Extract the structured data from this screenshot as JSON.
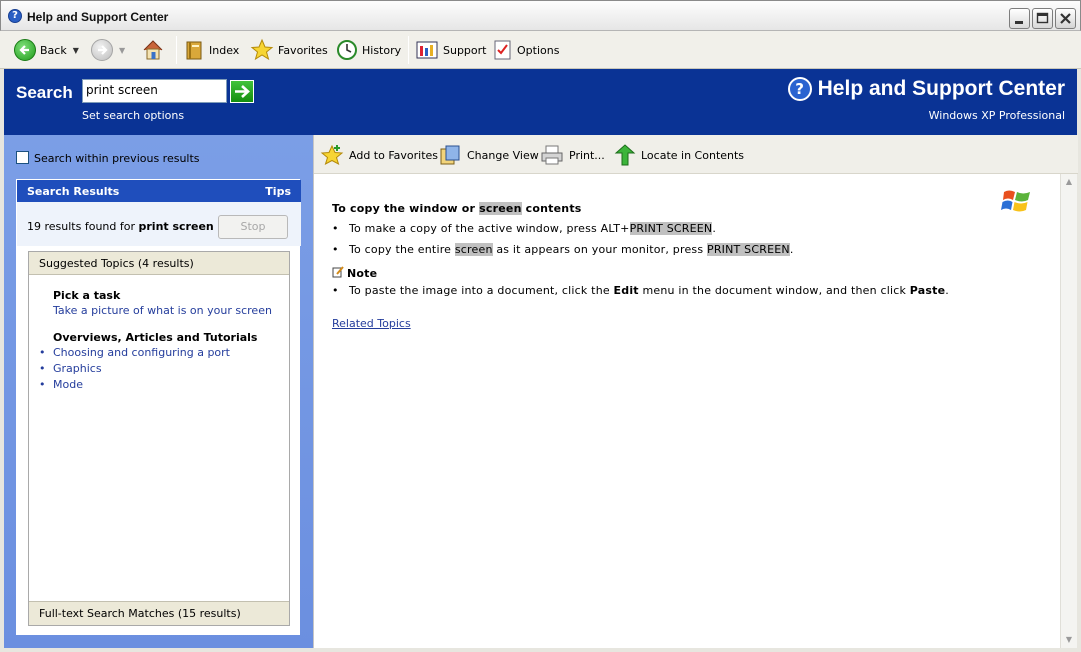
{
  "window": {
    "title": "Help and Support Center"
  },
  "toolbar": {
    "back": "Back",
    "index": "Index",
    "favorites": "Favorites",
    "history": "History",
    "support": "Support",
    "options": "Options"
  },
  "header": {
    "search_label": "Search",
    "search_value": "print screen",
    "search_options": "Set search options",
    "app_title": "Help and Support Center",
    "edition": "Windows XP Professional"
  },
  "left": {
    "search_within": "Search within previous results",
    "results_title": "Search Results",
    "tips": "Tips",
    "count_prefix": "19 results found for ",
    "count_query": "print screen",
    "stop": "Stop",
    "suggested": "Suggested Topics (4 results)",
    "groups": [
      {
        "title": "Pick a task",
        "items": [
          "Take a picture of what is on your screen"
        ]
      },
      {
        "title": "Overviews, Articles and Tutorials",
        "items": [
          "Choosing and configuring a port",
          "Graphics",
          "Mode"
        ]
      }
    ],
    "fulltext": "Full-text Search Matches (15 results)"
  },
  "content_toolbar": {
    "add_favorites": "Add to Favorites",
    "change_view": "Change View",
    "print": "Print...",
    "locate": "Locate in Contents"
  },
  "article": {
    "heading_pre": "To copy the window or ",
    "heading_hl": "screen",
    "heading_post": " contents",
    "b1_pre": "To make a copy of the active window, press ALT+",
    "b1_hl": "PRINT SCREEN",
    "b1_post": ".",
    "b2_pre": "To copy the entire ",
    "b2_hl": "screen",
    "b2_mid": " as it appears on your monitor, press ",
    "b2_hl2": "PRINT SCREEN",
    "b2_post": ".",
    "note_label": "Note",
    "note_pre": "To paste the image into a document, click the ",
    "note_edit": "Edit",
    "note_mid": " menu in the document window, and then click ",
    "note_paste": "Paste",
    "note_post": ".",
    "related": "Related Topics"
  }
}
